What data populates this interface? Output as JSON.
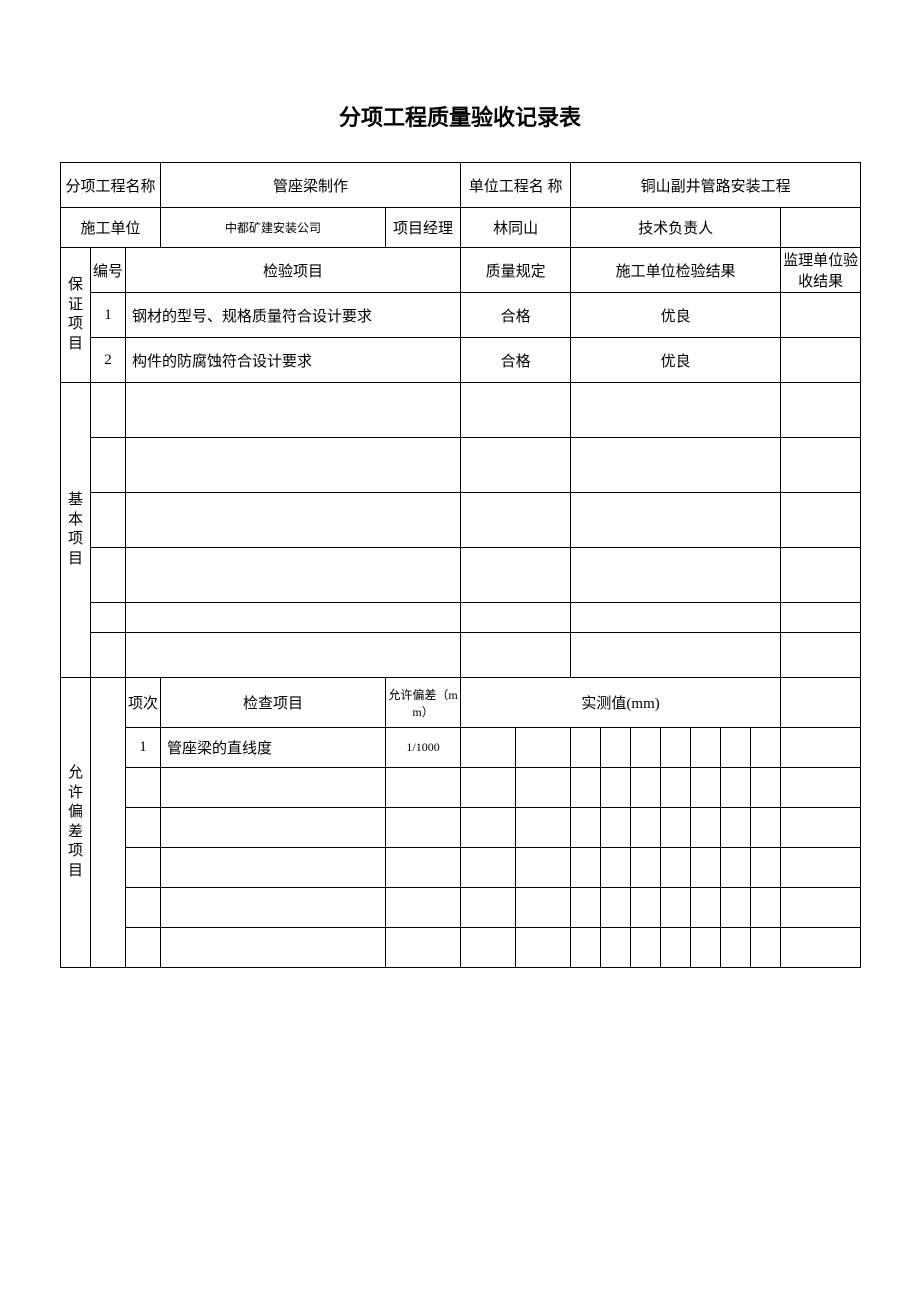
{
  "title": "分项工程质量验收记录表",
  "header": {
    "subproject_label": "分项工程名称",
    "subproject_name": "管座梁制作",
    "unitproject_label": "单位工程名 称",
    "unitproject_name": "铜山副井管路安装工程",
    "construction_label": "施工单位",
    "construction_name": "中都矿建安装公司",
    "pm_label": "项目经理",
    "pm_name": "林同山",
    "tech_label": "技术负责人",
    "tech_name": ""
  },
  "columns": {
    "no": "编号",
    "check_item": "检验项目",
    "quality_req": "质量规定",
    "construct_result": "施工单位检验结果",
    "supervise_result": "监理单位验收结果"
  },
  "sections": {
    "guarantee": "保证项目",
    "basic": "基本项目",
    "deviation": "允许偏差项目"
  },
  "guarantee_rows": [
    {
      "no": "1",
      "item": "钢材的型号、规格质量符合设计要求",
      "req": "合格",
      "result": "优良",
      "sup": ""
    },
    {
      "no": "2",
      "item": "构件的防腐蚀符合设计要求",
      "req": "合格",
      "result": "优良",
      "sup": ""
    }
  ],
  "basic_rows": [
    {
      "item": "",
      "req": "",
      "result": "",
      "sup": ""
    },
    {
      "item": "",
      "req": "",
      "result": "",
      "sup": ""
    },
    {
      "item": "",
      "req": "",
      "result": "",
      "sup": ""
    },
    {
      "item": "",
      "req": "",
      "result": "",
      "sup": ""
    },
    {
      "item": "",
      "req": "",
      "result": "",
      "sup": ""
    },
    {
      "item": "",
      "req": "",
      "result": "",
      "sup": ""
    }
  ],
  "deviation": {
    "seq": "项次",
    "check_label": "检查项目",
    "allow_label": "允许偏差（mm）",
    "measured_label": "实测值(mm)",
    "rows": [
      {
        "no": "1",
        "item": "管座梁的直线度",
        "allow": "1/1000"
      },
      {
        "no": "",
        "item": "",
        "allow": ""
      },
      {
        "no": "",
        "item": "",
        "allow": ""
      },
      {
        "no": "",
        "item": "",
        "allow": ""
      },
      {
        "no": "",
        "item": "",
        "allow": ""
      },
      {
        "no": "",
        "item": "",
        "allow": ""
      }
    ]
  }
}
